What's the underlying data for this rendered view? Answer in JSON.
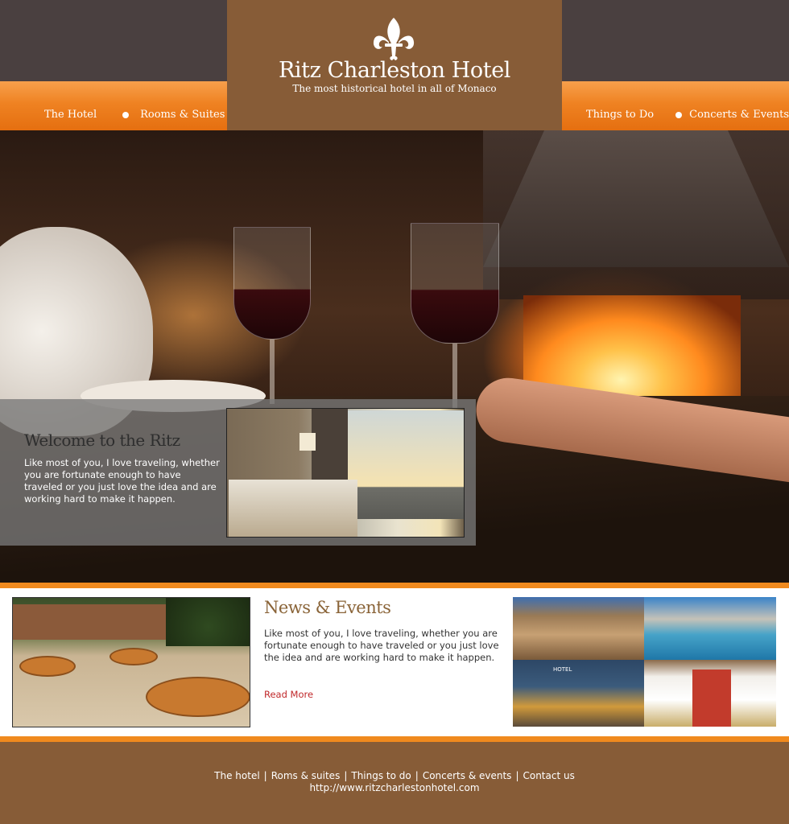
{
  "header": {
    "brand": "Ritz Charleston Hotel",
    "tagline": "The most historical hotel in all of Monaco",
    "logo_icon": "fleur-de-lis-icon"
  },
  "nav": {
    "left": [
      {
        "label": "The Hotel"
      },
      {
        "label": "Rooms & Suites"
      }
    ],
    "right": [
      {
        "label": "Things to Do"
      },
      {
        "label": "Concerts & Events"
      }
    ]
  },
  "welcome": {
    "title": "Welcome to the Ritz",
    "body": "Like most of you, I love traveling, whether you are fortunate enough to have traveled or you just love the idea and are working hard to make it happen."
  },
  "news": {
    "title": "News & Events",
    "body": "Like most of you, I love traveling, whether you are fortunate enough to have traveled or you just love the idea and are working hard to make it happen.",
    "read_more": "Read More"
  },
  "footer": {
    "links": [
      "The hotel",
      "Roms & suites",
      "Things to do",
      "Concerts & events",
      "Contact us"
    ],
    "separator": "|",
    "url": "http://www.ritzcharlestonhotel.com"
  },
  "colors": {
    "header_dark": "#4a4040",
    "nav_orange": "#ef8222",
    "banner_brown": "#875c37",
    "accent_orange": "#f08a1e",
    "news_title": "#8a6438",
    "read_more": "#c0282a"
  }
}
